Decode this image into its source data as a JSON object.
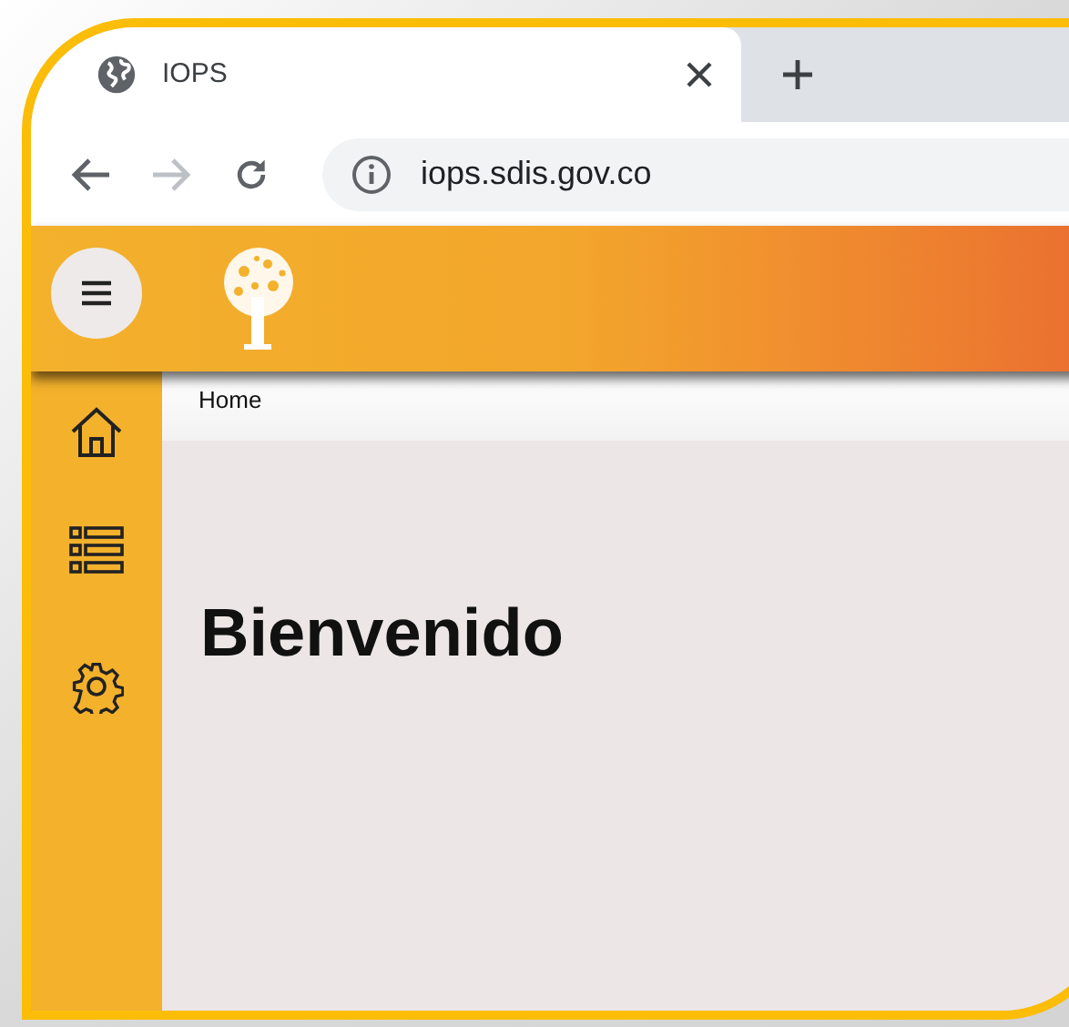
{
  "browser": {
    "tab": {
      "title": "IOPS"
    },
    "address_bar": {
      "url": "iops.sdis.gov.co"
    }
  },
  "breadcrumb": [
    "Home"
  ],
  "page": {
    "heading": "Bienvenido"
  }
}
